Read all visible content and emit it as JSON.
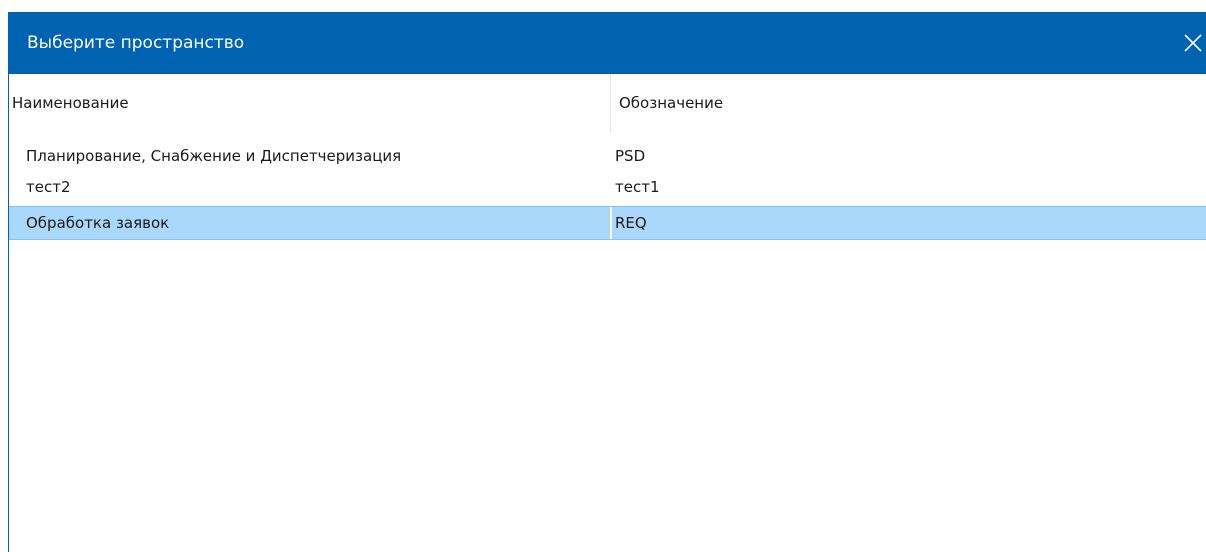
{
  "window": {
    "title": "Выберите пространство",
    "close_icon": "close-icon",
    "titlebar_color": "#0063b1"
  },
  "table": {
    "columns": [
      "Наименование",
      "Обозначение"
    ],
    "rows": [
      {
        "name": "Планирование, Снабжение и Диспетчеризация",
        "code": "PSD"
      },
      {
        "name": "тест2",
        "code": "тест1"
      },
      {
        "name": "Обработка заявок",
        "code": "REQ"
      }
    ],
    "selected_index": 2,
    "selection_color": "#a9d8fb"
  }
}
